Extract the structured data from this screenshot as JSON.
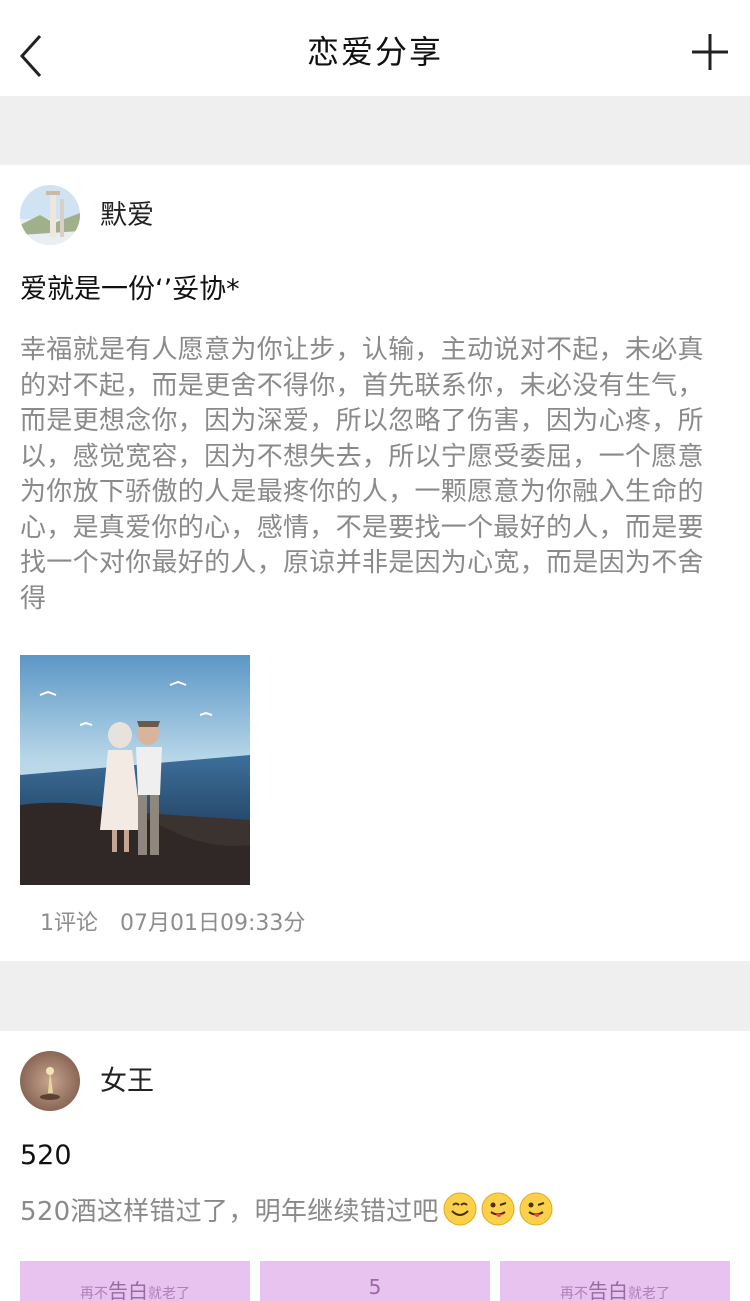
{
  "header": {
    "title": "恋爱分享",
    "back_icon": "chevron-left-icon",
    "add_icon": "plus-icon"
  },
  "posts": [
    {
      "author": "默爱",
      "title": "爱就是一份‘’妥协*",
      "body": "幸福就是有人愿意为你让步，认输，主动说对不起，未必真的对不起，而是更舍不得你，首先联系你，未必没有生气，而是更想念你，因为深爱，所以忽略了伤害，因为心疼，所以，感觉宽容，因为不想失去，所以宁愿受委屈，一个愿意为你放下骄傲的人是最疼你的人，一颗愿意为你融入生命的心，是真爱你的心，感情，不是要找一个最好的人，而是要找一个对你最好的人，原谅并非是因为心宽，而是因为不舍得",
      "comments": "1评论",
      "date": "07月01日09:33分"
    },
    {
      "author": "女王",
      "title": "520",
      "body": "520酒这样错过了，明年继续错过吧",
      "emojis": [
        "smile-emoji",
        "wink-tongue-emoji",
        "wink-tongue-emoji"
      ],
      "thumbs": [
        {
          "small1": "再不",
          "big": "告白",
          "small2": "就老了"
        },
        {
          "small1": "",
          "big": "5",
          "small2": ""
        },
        {
          "small1": "再不",
          "big": "告白",
          "small2": "就老了"
        }
      ]
    }
  ],
  "colors": {
    "background": "#ffffff",
    "separator": "#efeff0",
    "body_text": "#8a8a8a",
    "thumb_pink": "#e8c3ef"
  }
}
